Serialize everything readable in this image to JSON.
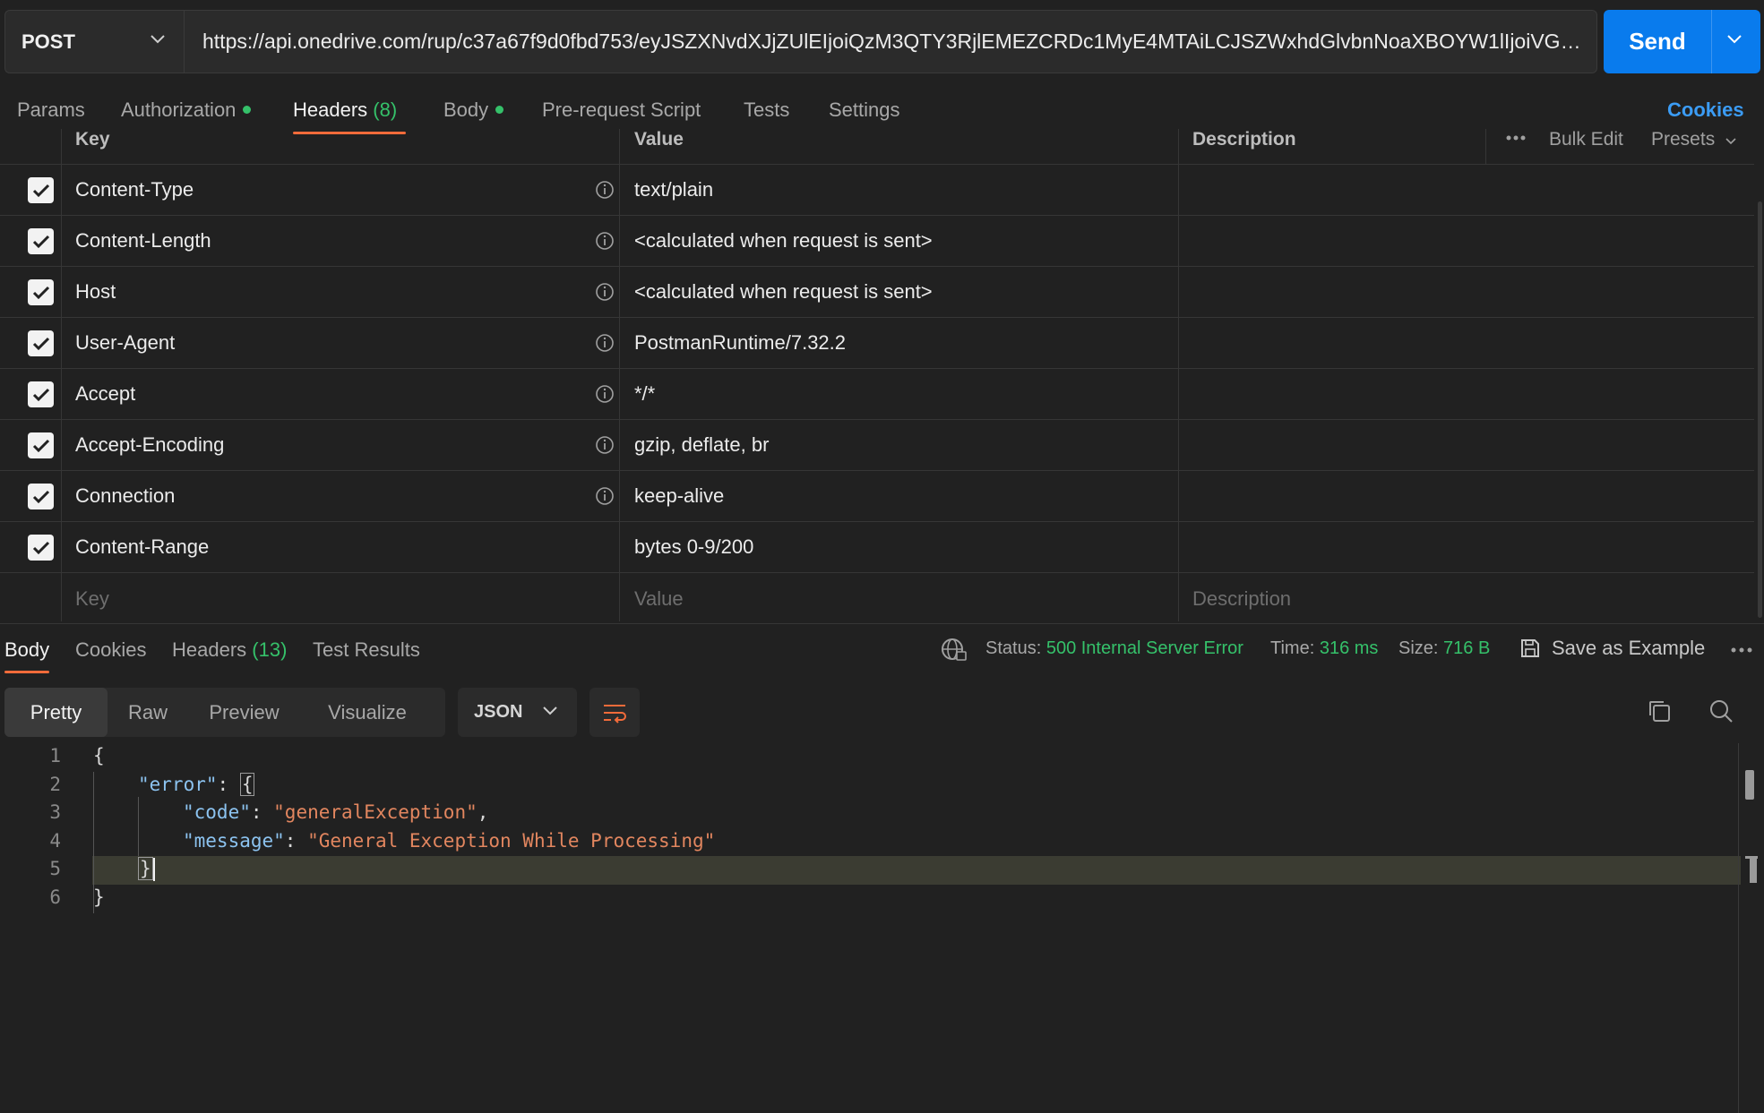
{
  "request": {
    "method": "POST",
    "url": "https://api.onedrive.com/rup/c37a67f9d0fbd753/eyJSZXNvdXJjZUlEIjoiQzM3QTY3RjlEMEZCRDc1MyE4MTAiLCJSZWxhdGlvbnNoaXBOYW1lIjoiVGVzdC5(...",
    "send_label": "Send"
  },
  "tabs": {
    "params": "Params",
    "authorization": "Authorization",
    "headers": "Headers",
    "headers_count": "(8)",
    "body": "Body",
    "prerequest": "Pre-request Script",
    "tests": "Tests",
    "settings": "Settings",
    "cookies": "Cookies"
  },
  "headers_table": {
    "col_key": "Key",
    "col_value": "Value",
    "col_description": "Description",
    "bulk_edit": "Bulk Edit",
    "presets": "Presets",
    "rows": [
      {
        "key": "Content-Type",
        "value": "text/plain"
      },
      {
        "key": "Content-Length",
        "value": "<calculated when request is sent>"
      },
      {
        "key": "Host",
        "value": "<calculated when request is sent>"
      },
      {
        "key": "User-Agent",
        "value": "PostmanRuntime/7.32.2"
      },
      {
        "key": "Accept",
        "value": "*/*"
      },
      {
        "key": "Accept-Encoding",
        "value": "gzip, deflate, br"
      },
      {
        "key": "Connection",
        "value": "keep-alive"
      },
      {
        "key": "Content-Range",
        "value": "bytes 0-9/200"
      }
    ],
    "placeholder_key": "Key",
    "placeholder_value": "Value",
    "placeholder_description": "Description"
  },
  "response": {
    "tabs": {
      "body": "Body",
      "cookies": "Cookies",
      "headers": "Headers",
      "headers_count": "(13)",
      "test_results": "Test Results"
    },
    "status_label": "Status:",
    "status_value": "500 Internal Server Error",
    "time_label": "Time:",
    "time_value": "316 ms",
    "size_label": "Size:",
    "size_value": "716 B",
    "save_example": "Save as Example",
    "view_modes": [
      "Pretty",
      "Raw",
      "Preview",
      "Visualize"
    ],
    "format": "JSON",
    "code": {
      "line_numbers": [
        "1",
        "2",
        "3",
        "4",
        "5",
        "6"
      ],
      "open_brace": "{",
      "close_brace": "}",
      "error_key": "\"error\"",
      "code_key": "\"code\"",
      "code_value": "\"generalException\"",
      "message_key": "\"message\"",
      "message_value": "\"General Exception While Processing\""
    }
  },
  "colors": {
    "accent_orange": "#f26b3a",
    "send_blue": "#097bed",
    "status_green": "#35c16a",
    "json_key": "#8cc3f0",
    "json_string": "#e2865f"
  }
}
